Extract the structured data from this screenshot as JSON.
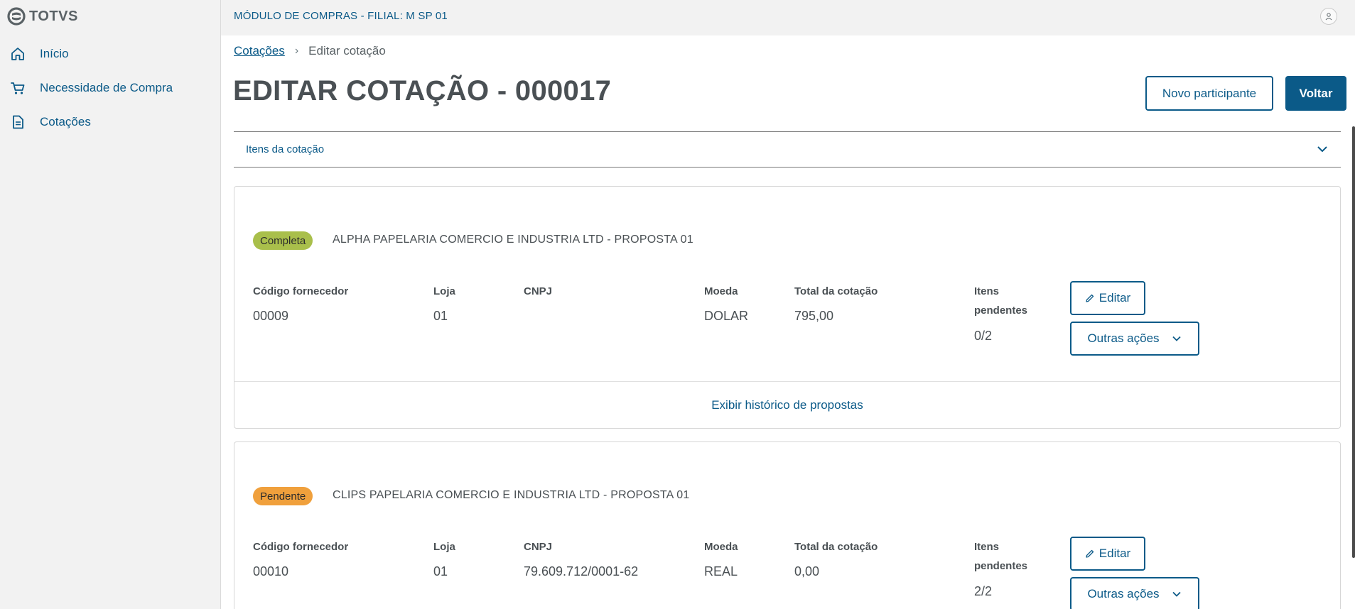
{
  "brand": {
    "name": "TOTVS",
    "logo_icon": "totvs-logo-icon"
  },
  "sidebar": {
    "items": [
      {
        "label": "Início",
        "icon": "home-icon"
      },
      {
        "label": "Necessidade de Compra",
        "icon": "cart-icon"
      },
      {
        "label": "Cotações",
        "icon": "document-icon"
      }
    ]
  },
  "topbar": {
    "title": "MÓDULO DE COMPRAS - FILIAL: M SP 01",
    "user_icon": "user-icon"
  },
  "breadcrumb": {
    "parent": "Cotações",
    "current": "Editar cotação"
  },
  "page": {
    "title": "EDITAR COTAÇÃO - 000017"
  },
  "actions": {
    "novo_participante": "Novo participante",
    "voltar": "Voltar"
  },
  "accordion": {
    "label": "Itens da cotação"
  },
  "labels": {
    "codigo": "Código fornecedor",
    "loja": "Loja",
    "cnpj": "CNPJ",
    "moeda": "Moeda",
    "total": "Total da cotação",
    "itens_line1": "Itens",
    "itens_line2": "pendentes",
    "editar": "Editar",
    "outras": "Outras ações",
    "historico": "Exibir histórico de propostas"
  },
  "proposals": [
    {
      "status": "Completa",
      "status_color": "#a9bf4b",
      "supplier": "ALPHA PAPELARIA COMERCIO E INDUSTRIA LTD - PROPOSTA 01",
      "codigo": "00009",
      "loja": "01",
      "cnpj": "",
      "moeda": "DOLAR",
      "total": "795,00",
      "itens_pendentes": "0/2"
    },
    {
      "status": "Pendente",
      "status_color": "#f0a03c",
      "supplier": "CLIPS PAPELARIA COMERCIO E INDUSTRIA LTD - PROPOSTA 01",
      "codigo": "00010",
      "loja": "01",
      "cnpj": "79.609.712/0001-62",
      "moeda": "REAL",
      "total": "0,00",
      "itens_pendentes": "2/2"
    }
  ],
  "colors": {
    "primary": "#0b5a88",
    "sidebar_bg": "#f2f2f2"
  }
}
